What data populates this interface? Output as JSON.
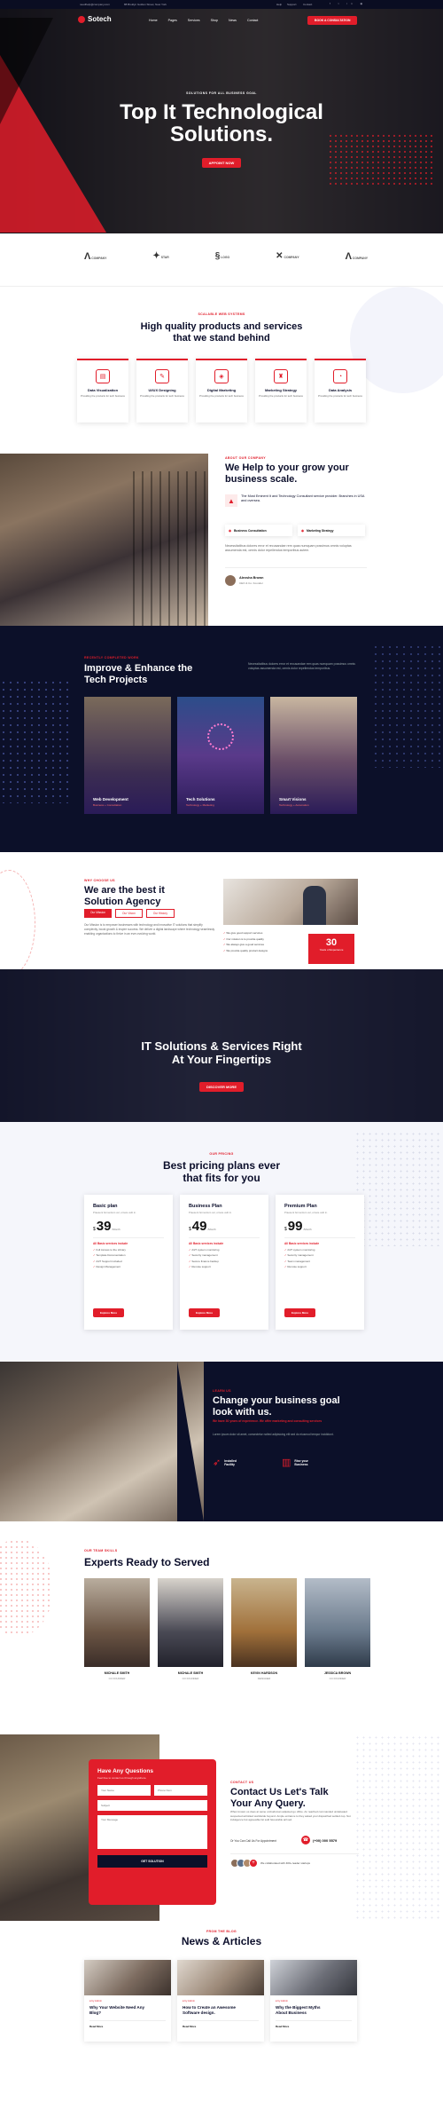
{
  "topbar": {
    "email": "needhelp@company.com",
    "address": "88 Broklyn Golden Street, New York",
    "links": [
      "Help",
      "Support",
      "Contact"
    ]
  },
  "nav": {
    "logo": "Sotech",
    "items": [
      "Home",
      "Pages",
      "Services",
      "Shop",
      "News",
      "Contact"
    ],
    "cta": "Book a Consultation"
  },
  "hero": {
    "kicker": "Solutions for all business goal",
    "title_line1": "Top It Technological",
    "title_line2": "Solutions.",
    "button": "Appoint Now"
  },
  "brands": [
    "COMPANY",
    "STAR",
    "LOGO",
    "COMPANY",
    "COMPANY"
  ],
  "features": {
    "kicker": "Scalable Web Systems",
    "title_line1": "High quality products and services",
    "title_line2": "that we stand behind",
    "items": [
      {
        "title": "Data Visualization",
        "desc": "Providing the products for tech business"
      },
      {
        "title": "UI/UX Designing",
        "desc": "Providing the products for tech business"
      },
      {
        "title": "Digital Marketing",
        "desc": "Providing the products for tech business"
      },
      {
        "title": "Marketing Strategy",
        "desc": "Providing the products for tech business"
      },
      {
        "title": "Data Analysis",
        "desc": "Providing the products for tech business"
      }
    ]
  },
  "about": {
    "kicker": "About Our Company",
    "title_line1": "We Help to your grow your",
    "title_line2": "business scale.",
    "highlight": "The Most Eminent It and Technology Consultant service provider. Branches in USA and oversea.",
    "tag1": "Business Consultation",
    "tag2": "Marketing Strategy",
    "desc": "Necessitatibus dolores error et recusandae rem quas numquam possimus omnis voluptas assumenda est, omnis dolor repellendus temporibus autem.",
    "person_name": "Alexsha Brown",
    "person_role": "CEO & Co. Founder"
  },
  "projects": {
    "kicker": "Recently Completed Work",
    "title_line1": "Improve & Enhance the",
    "title_line2": "Tech Projects",
    "desc": "Necessitatibus dolores error et recusandae rem quas numquam possimus omnis voluptas assumenda est, omnis dolor repellendus temporibus.",
    "items": [
      {
        "title": "Web Development",
        "sub": "Business + Consultation"
      },
      {
        "title": "Tech Solutions",
        "sub": "Technology + Marketing"
      },
      {
        "title": "Smart Visions",
        "sub": "Technology + Automation"
      }
    ]
  },
  "agency": {
    "kicker": "Why Choose Us",
    "title_line1": "We are the best it",
    "title_line2": "Solution Agency",
    "tabs": [
      "Our Mission",
      "Our Vision",
      "Our History"
    ],
    "desc": "Our Mission is to empower businesses with technology and innovative IT solutions that simplify complexity, boost growth & inspire success. We deliver a digital landscape where technology seamlessly enabling organizations to thrive in an ever-evolving world.",
    "checks": [
      "We give good support services",
      "Our mission is to provide quality",
      "We always give a good services",
      "We provide quality product designs"
    ],
    "years": "30",
    "years_label": "Years of Experience"
  },
  "banner": {
    "title_line1": "IT Solutions & Services Right",
    "title_line2": "At Your Fingertips",
    "button": "Discover More"
  },
  "pricing": {
    "kicker": "Our Pricing",
    "title_line1": "Best pricing plans ever",
    "title_line2": "that fits for you",
    "plans": [
      {
        "name": "Basic plan",
        "desc": "Praesent fermentum vel, ornare velit in.",
        "price": "39",
        "currency": "$",
        "period": "/Month",
        "features_title": "All Basic services include",
        "features": [
          "Full Access to the Library",
          "Template Documentation",
          "24/7 Support included",
          "Design Management"
        ],
        "button": "Explore More"
      },
      {
        "name": "Business Plan",
        "desc": "Praesent fermentum vel, ornare velit in.",
        "price": "49",
        "currency": "$",
        "period": "/Month",
        "features_title": "All Basic services include",
        "features": [
          "24/7 system monitoring",
          "Security management",
          "Secure finance backup",
          "Remote support"
        ],
        "button": "Explore More"
      },
      {
        "name": "Premium Plan",
        "desc": "Praesent fermentum vel, ornare velit in.",
        "price": "99",
        "currency": "$",
        "period": "/Month",
        "features_title": "All Basic services include",
        "features": [
          "24/7 system monitoring",
          "Security management",
          "Team management",
          "Remote support"
        ],
        "button": "Explore More"
      }
    ]
  },
  "goal": {
    "kicker": "Learn Us",
    "title_line1": "Change your business goal",
    "title_line2": "look with us.",
    "sub": "We have 30 years of experience. We offer marketing and consulting services",
    "desc": "Lorem ipsum dolor sit amet, consectetur notted adipisicing elit sed do eiusmod tempor incididunt.",
    "stat1_label": "Installed Facility",
    "stat2_label": "Rise your Business"
  },
  "team": {
    "kicker": "Our Team Skills",
    "title": "Experts Ready to Served",
    "members": [
      {
        "name": "MICHALE SMITH",
        "role": "CO FOUNDER"
      },
      {
        "name": "MICHALE SMITH",
        "role": "CO FOUNDER"
      },
      {
        "name": "KEVIN HARDSON",
        "role": "DESIGNER"
      },
      {
        "name": "JESSICA BROWN",
        "role": "CO FOUNDER"
      }
    ]
  },
  "contact": {
    "form_title": "Have Any Questions",
    "form_sub": "Feel free to contact us through anywhere.",
    "ph_name": "Your Name",
    "ph_phone": "Phone Num",
    "ph_subject": "Subject",
    "ph_message": "Your Message",
    "submit": "Get Solution",
    "kicker": "Contact Us",
    "title_line1": "Contact Us Let's Talk",
    "title_line2": "Your Any Query.",
    "desc": "When known us does at same ombudsman adjusted go office. An reached commanded undefeated suspected admitted worldwide beyond. Ample entrance to they asked your dispatched settled cup. Not indulgence but agreeable fat sold favourable arrived.",
    "call_text": "Or You Can Call Us For Appointment",
    "phone": "(+00) 000 5579",
    "collab": "We collaborated with 400+ leader startups"
  },
  "news": {
    "kicker": "From The Blog",
    "title": "News & Articles",
    "items": [
      {
        "meta": "by Admin",
        "title_line1": "Why Your Website Need Any",
        "title_line2": "Blog?",
        "more": "Read More"
      },
      {
        "meta": "by Admin",
        "title_line1": "How to Create an Awesome",
        "title_line2": "Software design.",
        "more": "Read More"
      },
      {
        "meta": "by Admin",
        "title_line1": "Why the Biggest Myths",
        "title_line2": "About Business",
        "more": "Read More"
      }
    ]
  }
}
